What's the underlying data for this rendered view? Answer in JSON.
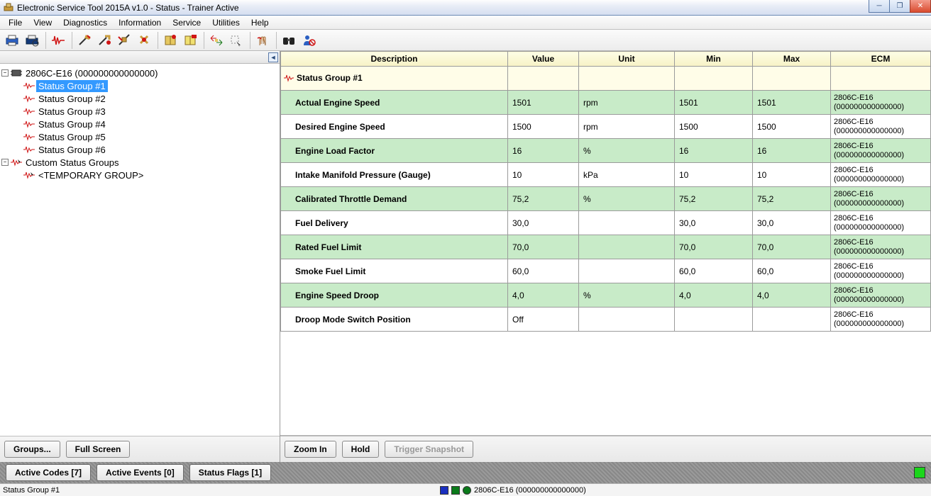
{
  "window": {
    "title": "Electronic Service Tool 2015A v1.0 - Status - Trainer Active"
  },
  "menu": [
    "File",
    "View",
    "Diagnostics",
    "Information",
    "Service",
    "Utilities",
    "Help"
  ],
  "tree": {
    "device": "2806C-E16 (000000000000000)",
    "groups": [
      "Status Group #1",
      "Status Group #2",
      "Status Group #3",
      "Status Group #4",
      "Status Group #5",
      "Status Group #6"
    ],
    "selected": "Status Group #1",
    "custom_label": "Custom Status Groups",
    "temp_label": "<TEMPORARY GROUP>"
  },
  "left_buttons": {
    "groups": "Groups...",
    "fullscreen": "Full Screen"
  },
  "table": {
    "headers": [
      "Description",
      "Value",
      "Unit",
      "Min",
      "Max",
      "ECM"
    ],
    "group_header": "Status Group #1",
    "ecm": "2806C-E16\n(000000000000000)",
    "rows": [
      {
        "alt": true,
        "desc": "Actual Engine Speed",
        "value": "1501",
        "unit": "rpm",
        "min": "1501",
        "max": "1501"
      },
      {
        "alt": false,
        "desc": "Desired Engine Speed",
        "value": "1500",
        "unit": "rpm",
        "min": "1500",
        "max": "1500"
      },
      {
        "alt": true,
        "desc": "Engine Load Factor",
        "value": "16",
        "unit": "%",
        "min": "16",
        "max": "16"
      },
      {
        "alt": false,
        "desc": "Intake Manifold Pressure (Gauge)",
        "value": "10",
        "unit": "kPa",
        "min": "10",
        "max": "10"
      },
      {
        "alt": true,
        "desc": "Calibrated Throttle Demand",
        "value": "75,2",
        "unit": "%",
        "min": "75,2",
        "max": "75,2"
      },
      {
        "alt": false,
        "desc": "Fuel Delivery",
        "value": "30,0",
        "unit": "",
        "min": "30,0",
        "max": "30,0"
      },
      {
        "alt": true,
        "desc": "Rated Fuel Limit",
        "value": "70,0",
        "unit": "",
        "min": "70,0",
        "max": "70,0"
      },
      {
        "alt": false,
        "desc": "Smoke Fuel Limit",
        "value": "60,0",
        "unit": "",
        "min": "60,0",
        "max": "60,0"
      },
      {
        "alt": true,
        "desc": "Engine Speed Droop",
        "value": "4,0",
        "unit": "%",
        "min": "4,0",
        "max": "4,0"
      },
      {
        "alt": false,
        "desc": "Droop Mode Switch Position",
        "value": "Off",
        "unit": "",
        "min": "",
        "max": ""
      }
    ]
  },
  "right_buttons": {
    "zoomin": "Zoom In",
    "hold": "Hold",
    "trigger": "Trigger Snapshot"
  },
  "tabs": {
    "codes": "Active Codes [7]",
    "events": "Active Events [0]",
    "flags": "Status Flags [1]"
  },
  "statusbar": {
    "left": "Status Group #1",
    "ecm": "2806C-E16 (000000000000000)"
  }
}
